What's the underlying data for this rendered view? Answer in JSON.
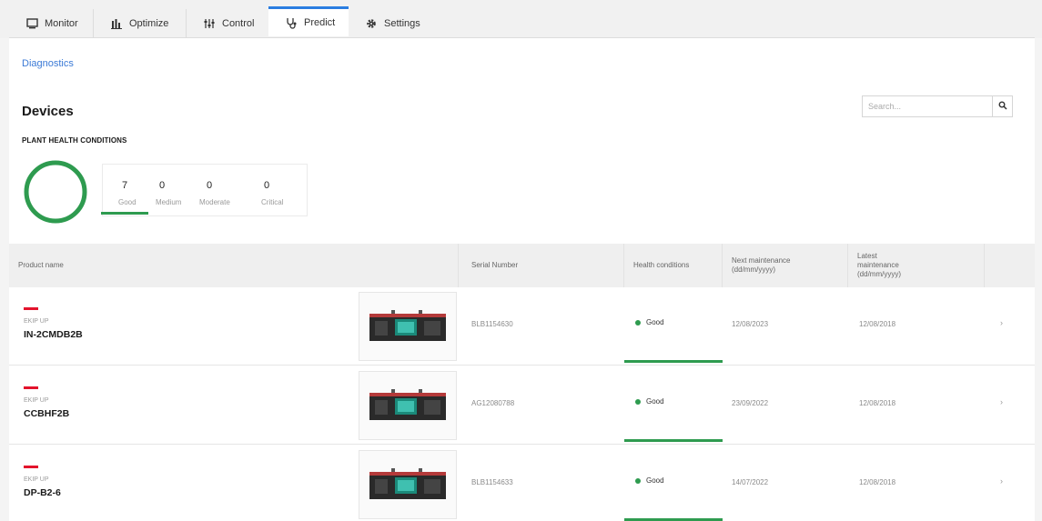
{
  "tabs": [
    {
      "label": "Monitor",
      "icon": "monitor-icon"
    },
    {
      "label": "Optimize",
      "icon": "bar-chart-icon"
    },
    {
      "label": "Control",
      "icon": "control-icon"
    },
    {
      "label": "Predict",
      "icon": "stethoscope-icon",
      "active": true
    },
    {
      "label": "Settings",
      "icon": "gear-icon"
    }
  ],
  "breadcrumb": "Diagnostics",
  "page_title": "Devices",
  "search": {
    "placeholder": "Search..."
  },
  "plant_health": {
    "label": "PLANT HEALTH CONDITIONS",
    "counts": [
      {
        "value": "7",
        "label": "Good"
      },
      {
        "value": "0",
        "label": "Medium"
      },
      {
        "value": "0",
        "label": "Moderate"
      },
      {
        "value": "0",
        "label": "Critical"
      }
    ]
  },
  "table": {
    "headers": {
      "product": "Product name",
      "serial": "Serial Number",
      "health": "Health conditions",
      "next_maint": "Next maintenance (dd/mm/yyyy)",
      "latest_maint": "Latest maintenance (dd/mm/yyyy)"
    },
    "rows": [
      {
        "brand": "EKIP UP",
        "name": "IN-2CMDB2B",
        "serial": "BLB1154630",
        "health": "Good",
        "next": "12/08/2023",
        "latest": "12/08/2018"
      },
      {
        "brand": "EKIP UP",
        "name": "CCBHF2B",
        "serial": "AG12080788",
        "health": "Good",
        "next": "23/09/2022",
        "latest": "12/08/2018"
      },
      {
        "brand": "EKIP UP",
        "name": "DP-B2-6",
        "serial": "BLB1154633",
        "health": "Good",
        "next": "14/07/2022",
        "latest": "12/08/2018"
      }
    ]
  },
  "colors": {
    "accent": "#2a7de1",
    "good": "#2e9b4f",
    "brand_red": "#e3132c"
  }
}
